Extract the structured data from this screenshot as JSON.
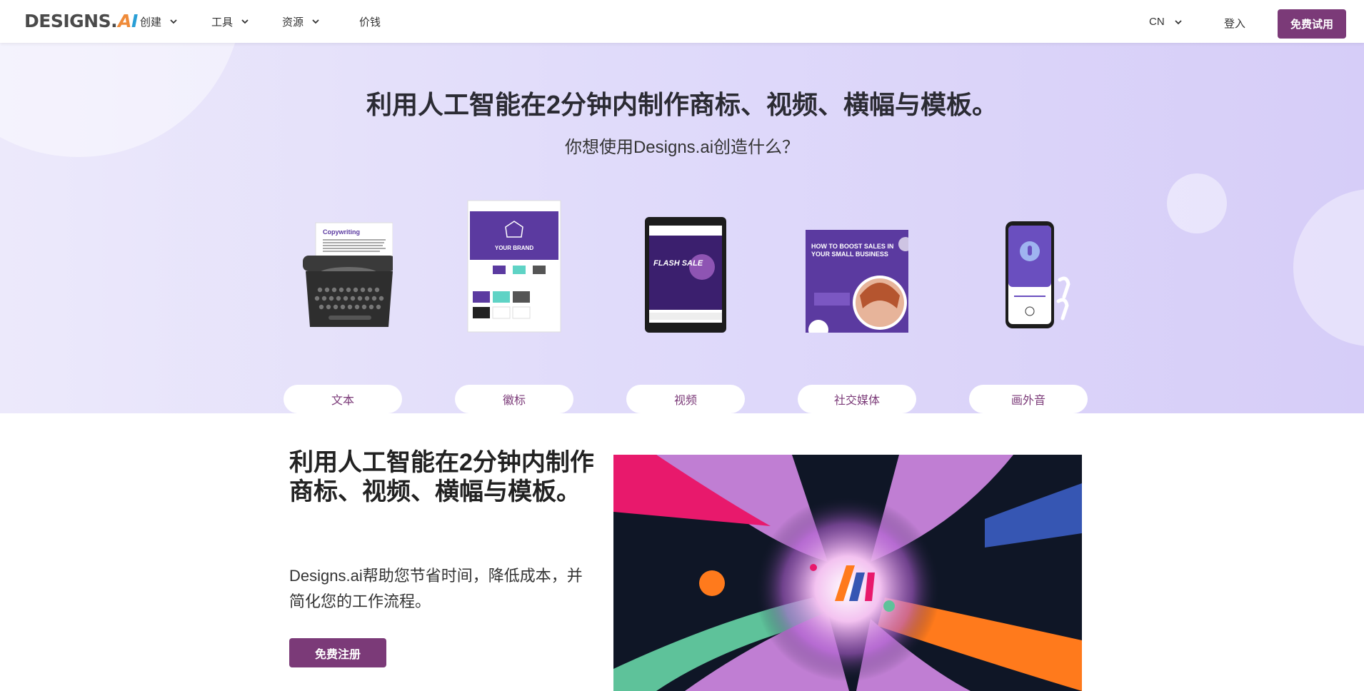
{
  "header": {
    "logo": {
      "main": "DESIGNS.",
      "ai_a": "A",
      "ai_i": "I"
    },
    "nav": [
      {
        "label": "创建",
        "dropdown": true
      },
      {
        "label": "工具",
        "dropdown": true
      },
      {
        "label": "资源",
        "dropdown": true
      },
      {
        "label": "价钱",
        "dropdown": false
      }
    ],
    "language": "CN",
    "login": "登入",
    "trial_button": "免费试用"
  },
  "hero": {
    "title": "利用人工智能在2分钟内制作商标、视频、横幅与模板。",
    "subtitle": "你想使用Designs.ai创造什么？",
    "categories": [
      {
        "label": "文本",
        "icon": "typewriter-icon"
      },
      {
        "label": "徽标",
        "icon": "logo-brand-sheet-icon"
      },
      {
        "label": "视频",
        "icon": "tablet-video-icon"
      },
      {
        "label": "社交媒体",
        "icon": "social-post-icon"
      },
      {
        "label": "画外音",
        "icon": "phone-voiceover-icon"
      }
    ],
    "card_texts": {
      "copywriting": "Copywriting",
      "your_brand": "YOUR BRAND",
      "flash_sale": "FLASH SALE",
      "social_headline": "HOW TO BOOST SALES IN YOUR SMALL BUSINESS"
    }
  },
  "section2": {
    "title": "利用人工智能在2分钟内制作商标、视频、横幅与模板。",
    "description": "Designs.ai帮助您节省时间，降低成本，并简化您的工作流程。",
    "signup_button": "免费注册"
  },
  "colors": {
    "brand_purple": "#7b3a78",
    "hero_bg": "#e0dbfa",
    "card_purple": "#5b3aa0"
  }
}
